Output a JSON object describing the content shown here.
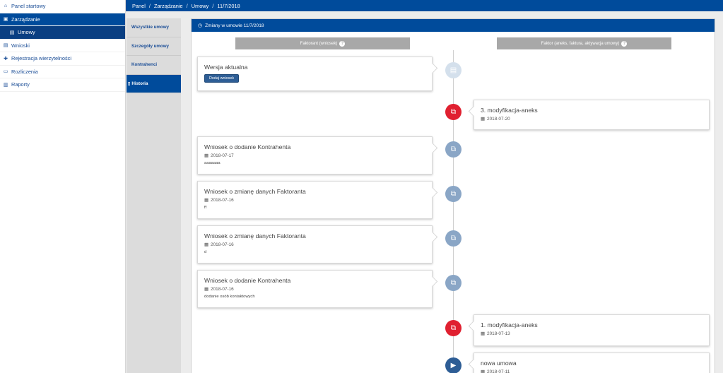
{
  "sidebar": {
    "items": [
      {
        "label": "Panel startowy",
        "icon": "dashboard-icon"
      },
      {
        "label": "Zarządzanie",
        "icon": "briefcase-icon"
      },
      {
        "label": "Umowy",
        "icon": "document-icon"
      },
      {
        "label": "Wnioski",
        "icon": "document-icon"
      },
      {
        "label": "Rejestracja wierzytelności",
        "icon": "plus-icon"
      },
      {
        "label": "Rozliczenia",
        "icon": "money-icon"
      },
      {
        "label": "Raporty",
        "icon": "chart-icon"
      }
    ]
  },
  "breadcrumb": {
    "items": [
      "Panel",
      "Zarządzanie",
      "Umowy",
      "11/7/2018"
    ],
    "separator": "/"
  },
  "tabs": [
    {
      "label": "Wszystkie umowy"
    },
    {
      "label": "Szczegóły umowy"
    },
    {
      "label": "Kontrahenci"
    },
    {
      "label": "Historia"
    }
  ],
  "panel": {
    "title": "Zmiany w umowie 11/7/2018",
    "left_header": "Faktorant (wniosek)",
    "right_header": "Faktor (aneks, faktura, aktywacja umowy)",
    "badge": "?"
  },
  "timeline": {
    "current": {
      "title": "Wersja aktualna",
      "button": "Dodaj wniosek"
    },
    "entries": [
      {
        "title": "3. modyfikacja-aneks",
        "date": "2018-07-20",
        "note": ""
      },
      {
        "title": "Wniosek o dodanie Kontrahenta",
        "date": "2018-07-17",
        "note": "aaaaaaa"
      },
      {
        "title": "Wniosek o zmianę danych Faktoranta",
        "date": "2018-07-16",
        "note": "ff"
      },
      {
        "title": "Wniosek o zmianę danych Faktoranta",
        "date": "2018-07-16",
        "note": "d"
      },
      {
        "title": "Wniosek o dodanie Kontrahenta",
        "date": "2018-07-16",
        "note": "dodanie osób kontaktowych"
      },
      {
        "title": "1. modyfikacja-aneks",
        "date": "2018-07-13",
        "note": ""
      },
      {
        "title": "nowa umowa",
        "date": "2018-07-11",
        "note": ""
      }
    ]
  },
  "colors": {
    "primary": "#004b9b",
    "accent_red": "#e02030",
    "dot_grey": "#8aa6c6",
    "header_grey": "#a8a8a8"
  }
}
